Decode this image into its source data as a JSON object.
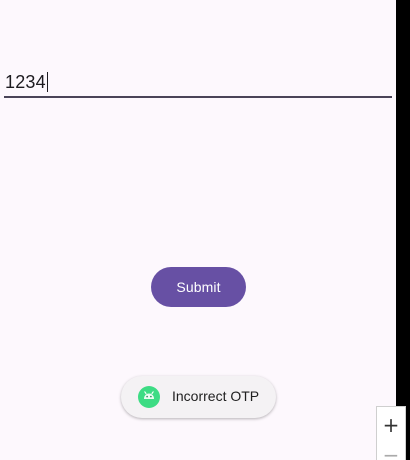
{
  "otp": {
    "value": "1234"
  },
  "actions": {
    "submit_label": "Submit"
  },
  "toast": {
    "icon": "android-icon",
    "message": "Incorrect OTP"
  },
  "zoom": {
    "in_label": "+",
    "out_label": "−"
  },
  "colors": {
    "primary": "#6750a4",
    "background": "#fdf8fd",
    "toast_icon": "#3ddc84"
  }
}
